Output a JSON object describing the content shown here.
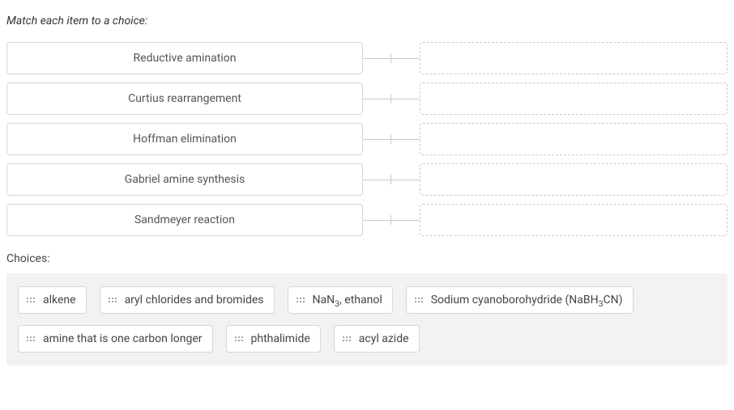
{
  "instruction": "Match each item to a choice:",
  "items": [
    {
      "label": "Reductive amination"
    },
    {
      "label": "Curtius rearrangement"
    },
    {
      "label": "Hoffman elimination"
    },
    {
      "label": "Gabriel amine synthesis"
    },
    {
      "label": "Sandmeyer reaction"
    }
  ],
  "choices_label": "Choices:",
  "choices": [
    {
      "label": "alkene"
    },
    {
      "label": "aryl chlorides and bromides"
    },
    {
      "label": "NaN3, ethanol",
      "html": "NaN<sub>3</sub>, ethanol"
    },
    {
      "label": "Sodium cyanoborohydride (NaBH3CN)",
      "html": "Sodium cyanoborohydride (NaBH<sub>3</sub>CN)"
    },
    {
      "label": "amine that is one carbon longer"
    },
    {
      "label": "phthalimide"
    },
    {
      "label": "acyl azide"
    }
  ]
}
